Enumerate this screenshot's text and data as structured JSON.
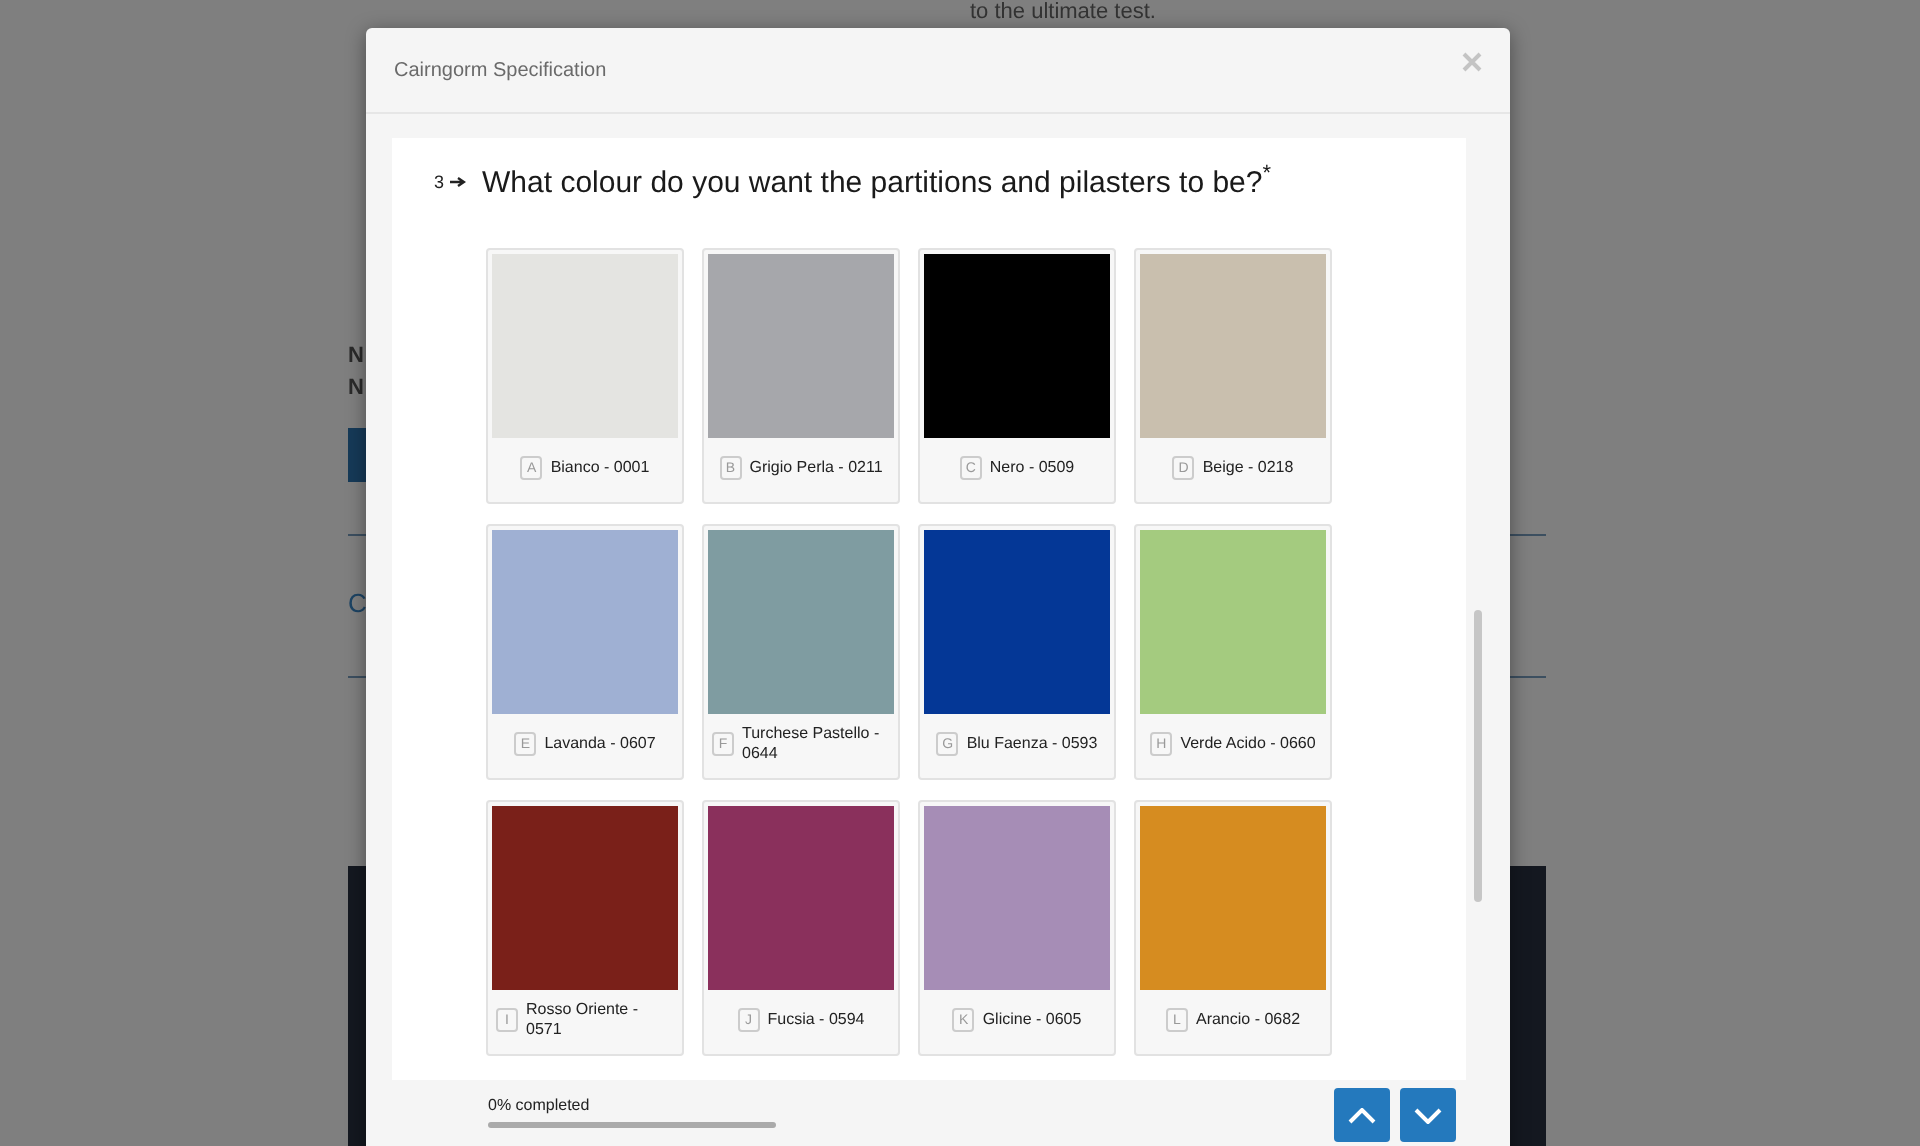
{
  "background_page": {
    "top_text": "to the ultimate test.",
    "lines": [
      "N",
      "N"
    ],
    "link": "C"
  },
  "dialog": {
    "title": "Cairngorm Specification",
    "question": {
      "number": "3",
      "text": "What colour do you want the partitions and pilasters to be?",
      "required_mark": "*"
    },
    "options": [
      {
        "key": "A",
        "label": "Bianco - 0001",
        "color": "#e4e4e1"
      },
      {
        "key": "B",
        "label": "Grigio Perla - 0211",
        "color": "#a6a7ab"
      },
      {
        "key": "C",
        "label": "Nero - 0509",
        "color": "#000000"
      },
      {
        "key": "D",
        "label": "Beige - 0218",
        "color": "#c9bfae"
      },
      {
        "key": "E",
        "label": "Lavanda - 0607",
        "color": "#9fb0d3"
      },
      {
        "key": "F",
        "label": "Turchese Pastello - 0644",
        "color": "#7f9ca1"
      },
      {
        "key": "G",
        "label": "Blu Faenza - 0593",
        "color": "#043796"
      },
      {
        "key": "H",
        "label": "Verde Acido - 0660",
        "color": "#a4cb7f"
      },
      {
        "key": "I",
        "label": "Rosso Oriente - 0571",
        "color": "#7a2019"
      },
      {
        "key": "J",
        "label": "Fucsia - 0594",
        "color": "#8a305c"
      },
      {
        "key": "K",
        "label": "Glicine - 0605",
        "color": "#a68db6"
      },
      {
        "key": "L",
        "label": "Arancio - 0682",
        "color": "#d68c20"
      }
    ],
    "footer": {
      "progress_text": "0% completed",
      "progress": {
        "level": 0
      }
    }
  }
}
